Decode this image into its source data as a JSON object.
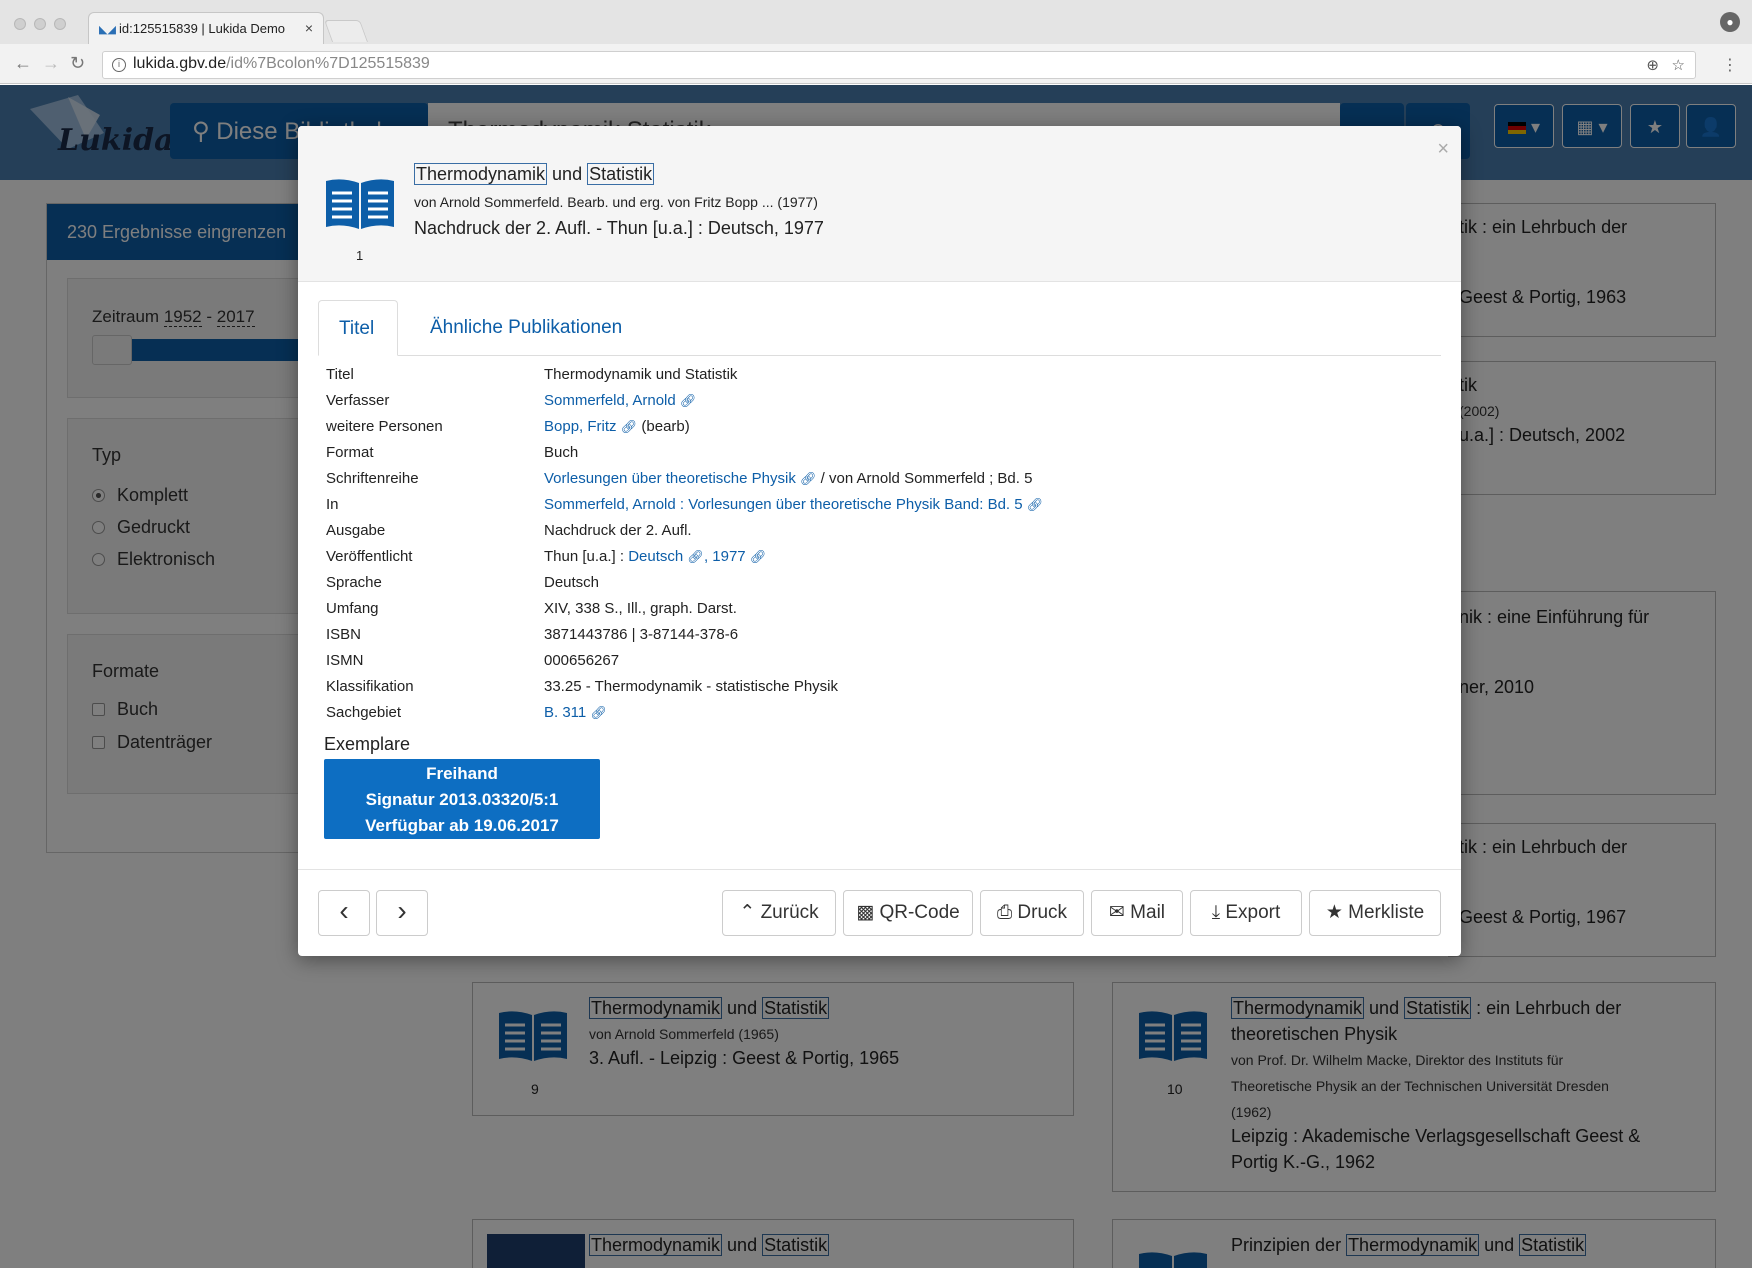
{
  "browser": {
    "tab_title": "id:125515839 | Lukida Demo",
    "tab_close": "×",
    "url_host": "lukida.gbv.de",
    "url_path": "/id%7Bcolon%7D125515839"
  },
  "site": {
    "logo_text": "Lukida",
    "location_button": "Diese Bibliothek",
    "search_value": "Thermodynamik Statistik"
  },
  "sidebar": {
    "header": "230 Ergebnisse eingrenzen",
    "zeitraum_label": "Zeitraum",
    "zeitraum_from": "1952",
    "zeitraum_sep": " - ",
    "zeitraum_to": "2017",
    "typ_label": "Typ",
    "typ_options": [
      "Komplett",
      "Gedruckt",
      "Elektronisch"
    ],
    "formate_label": "Formate",
    "formate_options": [
      "Buch",
      "Datenträger"
    ]
  },
  "background_results": {
    "r1_title": "tik : ein Lehrbuch der",
    "r1_pub": "Geest & Portig, 1963",
    "r2_title": "tik",
    "r2_sub": "(2002)",
    "r2_pub": "u.a.] : Deutsch, 2002",
    "r3_title": "nik : eine Einführung für",
    "r3_pub": "ner, 2010",
    "r4_title": "tik : ein Lehrbuch der",
    "r4_pub": "Geest & Portig, 1967",
    "card9": {
      "title_a": "Thermodynamik",
      "title_b": " und ",
      "title_c": "Statistik",
      "sub": "von Arnold Sommerfeld (1965)",
      "pub": "3. Aufl. - Leipzig : Geest & Portig, 1965",
      "num": "9"
    },
    "card10": {
      "title_a": "Thermodynamik",
      "title_b": " und ",
      "title_c": "Statistik",
      "title_d": " : ein Lehrbuch der",
      "title_e": "theoretischen Physik",
      "sub1": "von Prof. Dr. Wilhelm Macke, Direktor des Instituts für",
      "sub2": "Theoretische Physik an der Technischen Universität Dresden",
      "sub3": "(1962)",
      "pub1": "Leipzig : Akademische Verlagsgesellschaft Geest &",
      "pub2": "Portig K.-G., 1962",
      "num": "10"
    },
    "card11": {
      "title_a": "Thermodynamik",
      "title_b": " und ",
      "title_c": "Statistik"
    },
    "card12": {
      "title_pre": "Prinzipien der ",
      "title_a": "Thermodynamik",
      "title_b": " und ",
      "title_c": "Statistik"
    }
  },
  "modal": {
    "close": "×",
    "record_number": "1",
    "title_a": "Thermodynamik",
    "title_b": " und ",
    "title_c": "Statistik",
    "subtitle": "von Arnold Sommerfeld. Bearb. und erg. von Fritz Bopp ... (1977)",
    "publication": "Nachdruck der 2. Aufl. - Thun [u.a.] : Deutsch, 1977",
    "tabs": [
      "Titel",
      "Ähnliche Publikationen"
    ],
    "details": {
      "titel_k": "Titel",
      "titel_v": "Thermodynamik und Statistik",
      "verfasser_k": "Verfasser",
      "verfasser_v": "Sommerfeld, Arnold",
      "personen_k": "weitere Personen",
      "personen_v": "Bopp, Fritz",
      "personen_role": " (bearb)",
      "format_k": "Format",
      "format_v": "Buch",
      "reihe_k": "Schriftenreihe",
      "reihe_link": "Vorlesungen über theoretische Physik",
      "reihe_rest": " / von Arnold Sommerfeld ; Bd. 5",
      "in_k": "In",
      "in_v": "Sommerfeld, Arnold : Vorlesungen über theoretische Physik Band: Bd. 5",
      "ausgabe_k": "Ausgabe",
      "ausgabe_v": "Nachdruck der 2. Aufl.",
      "veroeff_k": "Veröffentlicht",
      "veroeff_pre": "Thun [u.a.] : ",
      "veroeff_link1": "Deutsch",
      "veroeff_comma": ", ",
      "veroeff_link2": "1977",
      "sprache_k": "Sprache",
      "sprache_v": "Deutsch",
      "umfang_k": "Umfang",
      "umfang_v": "XIV, 338 S., Ill., graph. Darst.",
      "isbn_k": "ISBN",
      "isbn_v": "3871443786 | 3-87144-378-6",
      "ismn_k": "ISMN",
      "ismn_v": "000656267",
      "klass_k": "Klassifikation",
      "klass_v": "33.25 - Thermodynamik - statistische Physik",
      "sach_k": "Sachgebiet",
      "sach_v": "B. 311"
    },
    "exemplare_label": "Exemplare",
    "exemplar": {
      "line1": "Freihand",
      "line2": "Signatur 2013.03320/5:1",
      "line3": "Verfügbar ab 19.06.2017"
    },
    "footer": {
      "prev": "‹",
      "next": "›",
      "zurueck": "Zurück",
      "qr": "QR-Code",
      "druck": "Druck",
      "mail": "Mail",
      "export": "Export",
      "merkliste": "Merkliste"
    }
  }
}
